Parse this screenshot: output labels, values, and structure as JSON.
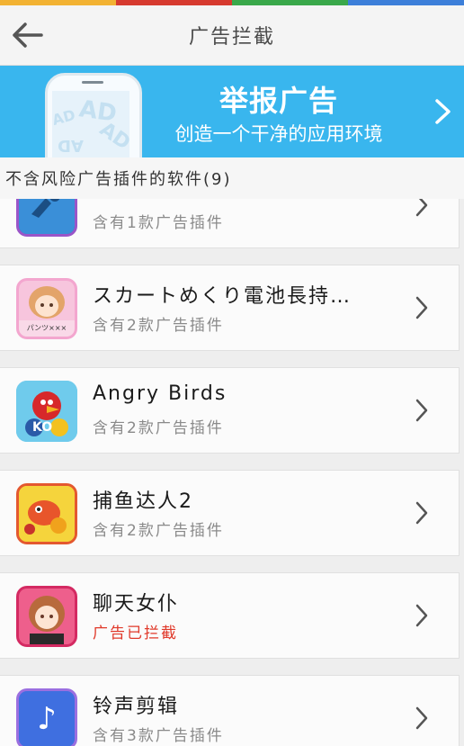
{
  "status_strip_colors": [
    "#f2b233",
    "#d63a2f",
    "#3aa84a",
    "#3d7fd9"
  ],
  "header": {
    "title": "广告拦截",
    "back_icon": "back-arrow-icon"
  },
  "banner": {
    "title": "举报广告",
    "subtitle": "创造一个干净的应用环境",
    "illustration_text": "AD",
    "background": "#39b6ee"
  },
  "section": {
    "label": "不含风险广告插件的软件(9)"
  },
  "apps": [
    {
      "name": "",
      "status": "含有1款广告插件",
      "blocked": false,
      "icon": "partial-app-icon"
    },
    {
      "name": "スカートめくり電池長持…",
      "status": "含有2款广告插件",
      "blocked": false,
      "icon": "anime-girl-app-icon",
      "icon_caption": "パンツ×××"
    },
    {
      "name": "Angry Birds",
      "status": "含有2款广告插件",
      "blocked": false,
      "icon": "angry-birds-app-icon",
      "icon_caption": "KO"
    },
    {
      "name": "捕鱼达人2",
      "status": "含有2款广告插件",
      "blocked": false,
      "icon": "fishing-app-icon"
    },
    {
      "name": "聊天女仆",
      "status": "广告已拦截",
      "blocked": true,
      "icon": "maid-chat-app-icon"
    },
    {
      "name": "铃声剪辑",
      "status": "含有3款广告插件",
      "blocked": false,
      "icon": "music-note-app-icon",
      "icon_glyph": "♪"
    }
  ],
  "colors": {
    "blocked_status": "#e0392a",
    "normal_status": "#8a8a8a"
  }
}
